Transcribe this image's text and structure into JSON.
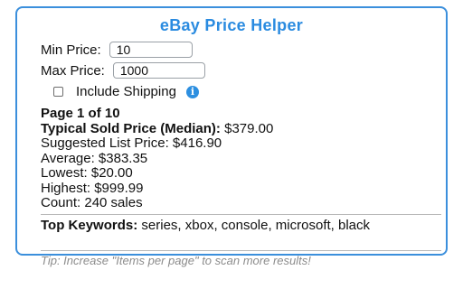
{
  "popup": {
    "title": "eBay Price Helper",
    "min_price": {
      "label": "Min Price:",
      "value": "10"
    },
    "max_price": {
      "label": "Max Price:",
      "value": "1000"
    },
    "include_shipping": {
      "label": "Include Shipping",
      "checked": false,
      "info_icon": "info-icon"
    },
    "page_info": "Page 1 of 10",
    "median": {
      "label": "Typical Sold Price (Median):",
      "value": "$379.00"
    },
    "suggested": "Suggested List Price: $416.90",
    "average": "Average: $383.35",
    "lowest": "Lowest: $20.00",
    "highest": "Highest: $999.99",
    "count": "Count: 240 sales",
    "keywords": {
      "label": "Top Keywords:",
      "value": "series, xbox, console, microsoft, black"
    },
    "tip": "Tip: Increase \"Items per page\" to scan more results!"
  },
  "colors": {
    "accent": "#2a8be0",
    "border": "#3b8fdc",
    "tip_text": "#8c8c8c"
  }
}
